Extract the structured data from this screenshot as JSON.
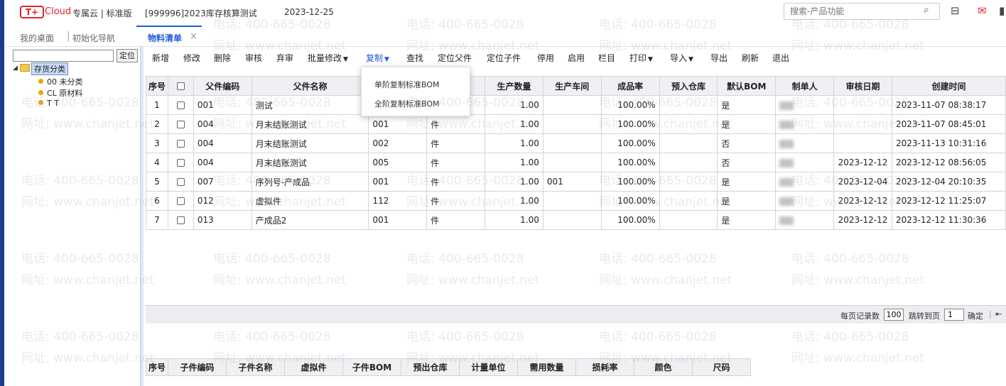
{
  "header": {
    "logo_mark": "T+",
    "logo_text": "Cloud",
    "edition": "专属云 | 标准版",
    "account": "[999996]2023库存核算测试",
    "login_date": "2023-12-25",
    "search_placeholder": "搜索-产品功能"
  },
  "tabs": [
    {
      "label": "我的桌面"
    },
    {
      "label": "初始化导航"
    },
    {
      "label": "物料清单",
      "active": true
    }
  ],
  "tree": {
    "locate_label": "定位",
    "root": "存货分类",
    "items": [
      "00 未分类",
      "CL 原材料",
      "T T"
    ]
  },
  "toolbar": {
    "buttons": [
      "新增",
      "修改",
      "删除",
      "审核",
      "弃审",
      "批量修改",
      "复制",
      "查找",
      "定位父件",
      "定位子件",
      "停用",
      "启用",
      "栏目",
      "打印",
      "导入",
      "导出",
      "刷新",
      "退出"
    ],
    "copy_menu": [
      "单阶复制标准BOM",
      "全阶复制标准BOM"
    ]
  },
  "table": {
    "columns": [
      "序号",
      "",
      "父件编码",
      "父件名称",
      "",
      "",
      "生产数量",
      "生产车间",
      "成品率",
      "预入仓库",
      "默认BOM",
      "制单人",
      "审核日期",
      "创建时间"
    ],
    "rows": [
      [
        "1",
        "",
        "001",
        "测试",
        "",
        "",
        "1.00",
        "",
        "100.00%",
        "",
        "是",
        "",
        "",
        "2023-11-07 08:38:17"
      ],
      [
        "2",
        "",
        "004",
        "月末结账测试",
        "001",
        "件",
        "1.00",
        "",
        "100.00%",
        "",
        "是",
        "",
        "",
        "2023-11-07 08:45:01"
      ],
      [
        "3",
        "",
        "004",
        "月末结账测试",
        "002",
        "件",
        "1.00",
        "",
        "100.00%",
        "",
        "否",
        "",
        "",
        "2023-11-13 10:31:16"
      ],
      [
        "4",
        "",
        "004",
        "月末结账测试",
        "005",
        "件",
        "1.00",
        "",
        "100.00%",
        "",
        "否",
        "",
        "2023-12-12",
        "2023-12-12 08:56:05"
      ],
      [
        "5",
        "",
        "007",
        "序列号-产成品",
        "001",
        "件",
        "1.00",
        "001",
        "100.00%",
        "",
        "是",
        "",
        "2023-12-04",
        "2023-12-04 20:10:35"
      ],
      [
        "6",
        "",
        "012",
        "虚拟件",
        "112",
        "件",
        "1.00",
        "",
        "100.00%",
        "",
        "是",
        "",
        "2023-12-12",
        "2023-12-12 11:25:07"
      ],
      [
        "7",
        "",
        "013",
        "产成品2",
        "001",
        "件",
        "1.00",
        "",
        "100.00%",
        "",
        "是",
        "",
        "2023-12-12",
        "2023-12-12 11:30:36"
      ]
    ]
  },
  "pager": {
    "page_size_label": "每页记录数",
    "page_size": "100",
    "jump_label": "跳转到页",
    "jump_page": "1",
    "confirm_label": "确定"
  },
  "subtable": {
    "columns": [
      "序号",
      "子件编码",
      "子件名称",
      "虚拟件",
      "子件BOM",
      "预出仓库",
      "计量单位",
      "需用数量",
      "损耗率",
      "颜色",
      "尺码"
    ]
  },
  "watermark": {
    "phone": "电话: 400-665-0028",
    "site": "网址: www.chanjet.net"
  }
}
